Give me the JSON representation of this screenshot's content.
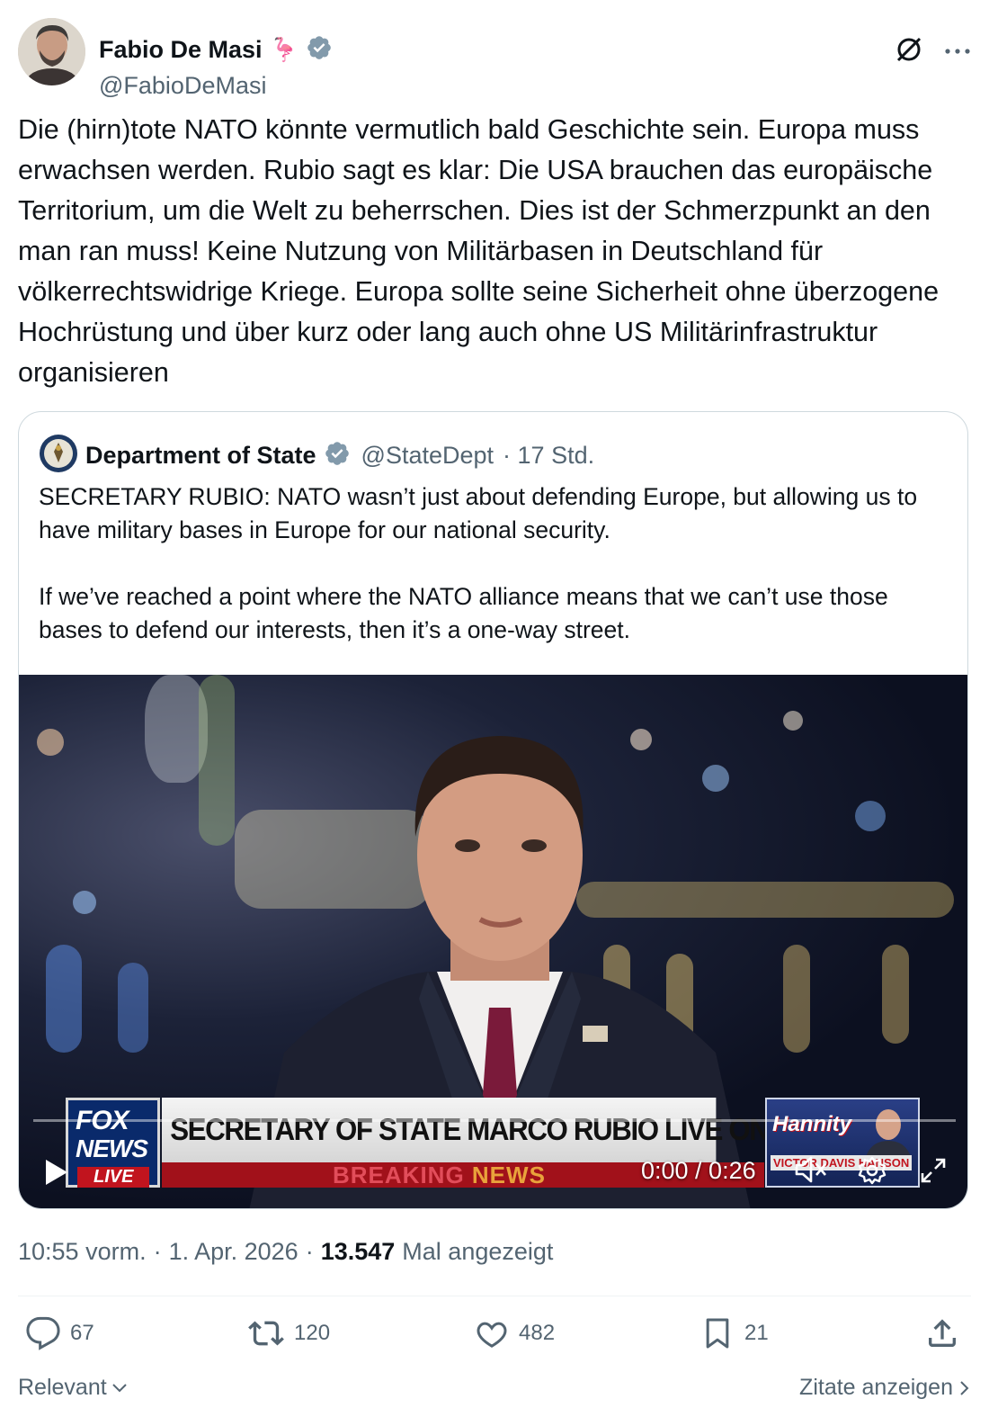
{
  "author": {
    "display_name": "Fabio De Masi",
    "emoji": "🦩",
    "handle": "@FabioDeMasi"
  },
  "tweet": {
    "text": "Die (hirn)tote NATO könnte vermutlich bald Geschichte sein. Europa muss erwachsen werden. Rubio sagt es klar: Die USA brauchen das europäische Territorium, um die Welt zu beherrschen. Dies ist der Schmerzpunkt an den man ran muss! Keine Nutzung von Militärbasen in Deutschland für völkerrechtswidrige Kriege. Europa sollte seine Sicherheit ohne überzogene Hochrüstung und über kurz oder lang auch ohne US Militärinfrastruktur organisieren"
  },
  "quote": {
    "name": "Department of State",
    "handle": "@StateDept",
    "time": "· 17 Std.",
    "text": "SECRETARY RUBIO: NATO wasn’t just about defending Europe, but allowing us to have military bases in Europe for our national security.\n\nIf we’ve reached a point where the NATO alliance means that we can’t use those bases to defend our interests, then it’s a one-way street.",
    "video": {
      "headline": "SECRETARY OF STATE MARCO RUBIO LIVE ON HANNITY",
      "breaking": "BREAKING",
      "news": "NEWS",
      "logo_line1": "FOX",
      "logo_line2": "NEWS",
      "logo_line3": "LIVE",
      "show_name": "Hannity",
      "guest": "VICTOR DAVIS HANSON",
      "time": "0:00 / 0:26",
      "progress": 0
    }
  },
  "meta": {
    "time": "10:55 vorm.",
    "sep1": "·",
    "date": "1. Apr. 2026",
    "sep2": "·",
    "views": "13.547",
    "views_label": "Mal angezeigt"
  },
  "actions": {
    "replies": "67",
    "reposts": "120",
    "likes": "482",
    "bookmarks": "21"
  },
  "footer": {
    "sort_label": "Relevant",
    "quotes_label": "Zitate anzeigen"
  },
  "colors": {
    "text": "#0f1419",
    "secondary": "#536471",
    "verified": "#829aab",
    "border": "#cfd9de"
  }
}
